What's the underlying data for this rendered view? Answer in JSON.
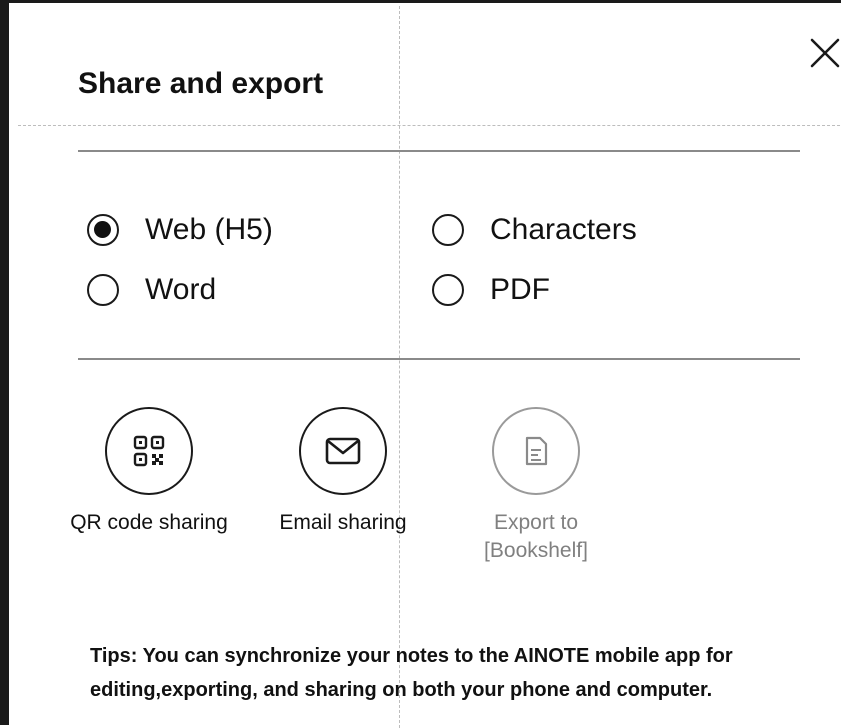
{
  "dialog": {
    "title": "Share and export",
    "close_icon": "close-icon"
  },
  "format_options": [
    {
      "label": "Web (H5)",
      "selected": true
    },
    {
      "label": "Characters",
      "selected": false
    },
    {
      "label": "Word",
      "selected": false
    },
    {
      "label": "PDF",
      "selected": false
    }
  ],
  "actions": [
    {
      "label": "QR code sharing",
      "icon": "qr-code-icon",
      "enabled": true
    },
    {
      "label": "Email sharing",
      "icon": "envelope-icon",
      "enabled": true
    },
    {
      "label_line1": "Export to",
      "label_line2": "[Bookshelf]",
      "icon": "document-icon",
      "enabled": false
    }
  ],
  "tips": {
    "line1": "Tips: You can synchronize your notes to the AINOTE mobile app for",
    "line2": "editing,exporting, and sharing on both your phone and computer."
  },
  "colors": {
    "text": "#111111",
    "disabled_text": "#808080",
    "divider": "#8a8a8a",
    "border": "#1a1a1a"
  }
}
